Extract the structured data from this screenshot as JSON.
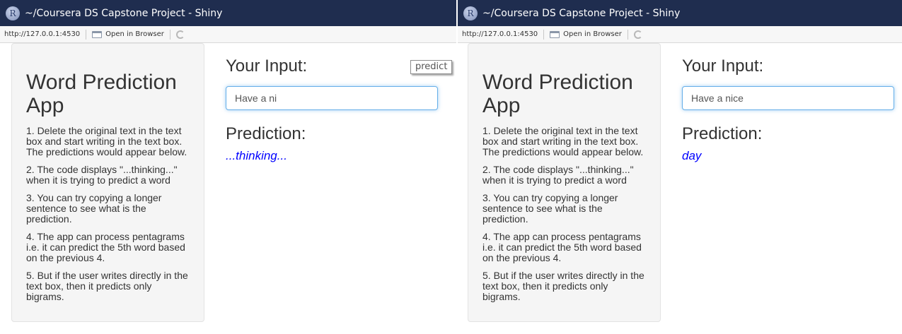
{
  "windows": [
    {
      "title": "~/Coursera DS Capstone Project - Shiny",
      "url": "http://127.0.0.1:4530",
      "open_browser_label": "Open in Browser",
      "sidebar": {
        "title": "Word Prediction App",
        "instructions": [
          "1. Delete the original text in the text box and start writing in the text box. The predictions would appear below.",
          "2. The code displays \"...thinking...\" when it is trying to predict a word",
          "3. You can try copying a longer sentence to see what is the prediction.",
          "4. The app can process pentagrams i.e. it can predict the 5th word based on the previous 4.",
          "5. But if the user writes directly in the text box, then it predicts only bigrams."
        ]
      },
      "main": {
        "input_label": "Your Input:",
        "input_value": "Have a ni",
        "prediction_label": "Prediction:",
        "prediction_value": "...thinking..."
      },
      "tooltip": "predict"
    },
    {
      "title": "~/Coursera DS Capstone Project - Shiny",
      "url": "http://127.0.0.1:4530",
      "open_browser_label": "Open in Browser",
      "sidebar": {
        "title": "Word Prediction App",
        "instructions": [
          "1. Delete the original text in the text box and start writing in the text box. The predictions would appear below.",
          "2. The code displays \"...thinking...\" when it is trying to predict a word",
          "3. You can try copying a longer sentence to see what is the prediction.",
          "4. The app can process pentagrams i.e. it can predict the 5th word based on the previous 4.",
          "5. But if the user writes directly in the text box, then it predicts only bigrams."
        ]
      },
      "main": {
        "input_label": "Your Input:",
        "input_value": "Have a nice",
        "prediction_label": "Prediction:",
        "prediction_value": "day"
      }
    }
  ],
  "colors": {
    "titlebar": "#1f2d4f",
    "prediction_text": "#0000ff",
    "input_focus": "#66afe9"
  },
  "icons": [
    "r-logo-icon",
    "browser-icon",
    "refresh-icon"
  ]
}
